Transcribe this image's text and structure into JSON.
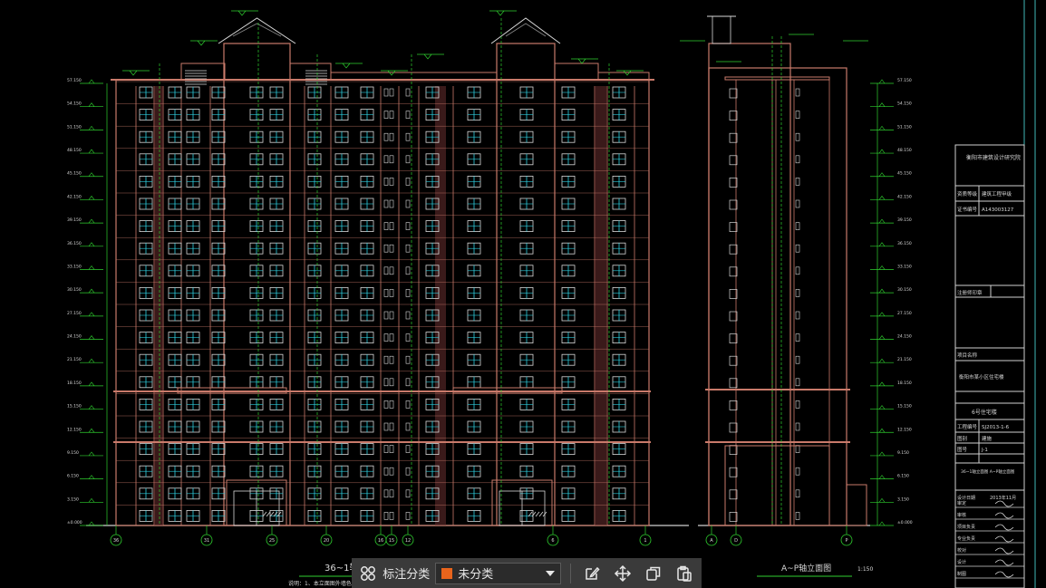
{
  "drawing": {
    "front_elevation_title": "36~1轴",
    "side_elevation_title": "A~P轴立面图",
    "side_scale": "1:150",
    "note": "说明：1、本立面图外墙色彩详见",
    "elev_labels_left": [
      "57.150",
      "54.150",
      "51.150",
      "48.150",
      "45.150",
      "42.150",
      "39.150",
      "36.150",
      "33.150",
      "30.150",
      "27.150",
      "24.150",
      "21.150",
      "18.150",
      "15.150",
      "12.150",
      "9.150",
      "6.150",
      "3.150",
      "±0.000"
    ],
    "elev_labels_right": [
      "57.150",
      "54.150",
      "51.150",
      "48.150",
      "45.150",
      "42.150",
      "39.150",
      "36.150",
      "33.150",
      "30.150",
      "27.150",
      "24.150",
      "21.150",
      "18.150",
      "15.150",
      "12.150",
      "9.150",
      "6.150",
      "3.150",
      "±0.000"
    ],
    "axis_bubbles_front": [
      "36",
      "31",
      "25",
      "20",
      "16",
      "15",
      "12",
      "6",
      "1"
    ],
    "axis_bubbles_side": [
      "A",
      "D",
      "P"
    ]
  },
  "title_block": {
    "company": "衡阳市建筑设计研究院",
    "row1_label": "资质等级",
    "row1_value": "建筑工程甲级",
    "row2_label": "证书编号",
    "row2_value": "A143003127",
    "stamp_label": "注册师印章",
    "project_label": "项目名称",
    "project_name": "衡阳市某小区住宅楼",
    "subproject": "6号住宅楼",
    "job_no_label": "工程编号",
    "job_no": "SJ2013-1-6",
    "stage_label": "图别",
    "stage": "建施",
    "sheet_label": "图号",
    "sheet": "J-1",
    "drawing_name": "36~1轴立面图 A~P轴立面图",
    "sign_rows": [
      "审定",
      "审核",
      "项目负责",
      "专业负责",
      "校对",
      "设计",
      "制图"
    ],
    "date_label": "设计日期",
    "date": "2013年11月"
  },
  "toolbar": {
    "grid_icon": "grid-apps-icon",
    "label": "标注分类",
    "select_value": "未分类",
    "select_color": "#e8641c",
    "actions": [
      "edit-icon",
      "move-icon",
      "copy-icon",
      "paste-icon"
    ]
  }
}
